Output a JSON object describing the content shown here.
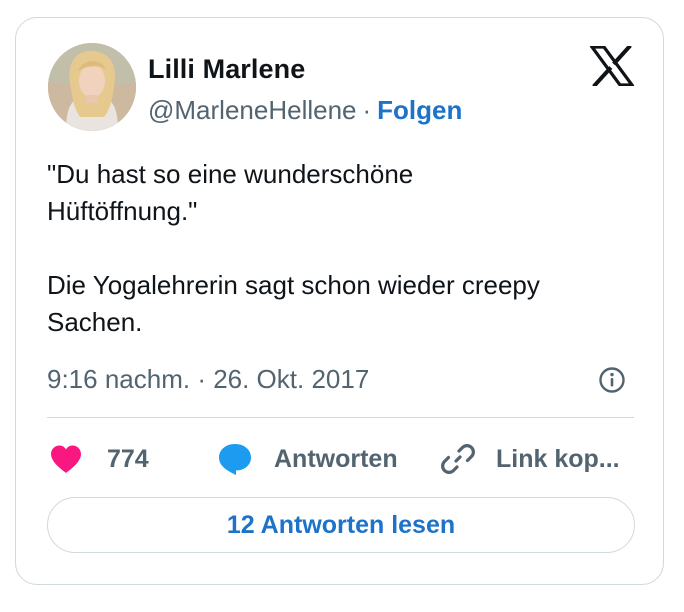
{
  "author": {
    "name": "Lilli Marlene",
    "handle": "@MarleneHellene",
    "separator": "·",
    "follow_label": "Folgen"
  },
  "brand": {
    "logo_icon": "x-logo-icon"
  },
  "tweet": {
    "line1": "\"Du hast so eine wunderschöne",
    "line2": "Hüftöffnung.\"",
    "line3": "Die Yogalehrerin sagt schon wieder creepy",
    "line4": "Sachen.",
    "timestamp": "9:16 nachm. · 26. Okt. 2017"
  },
  "actions": {
    "like_count": "774",
    "reply_label": "Antworten",
    "copy_label": "Link kop..."
  },
  "footer": {
    "read_replies_label": "12 Antworten lesen"
  },
  "colors": {
    "like": "#f91880",
    "reply_icon": "#1d9bf0",
    "link_text": "#1d73c9",
    "muted": "#536471",
    "border": "#cfd9de"
  },
  "icons": [
    "avatar",
    "x-logo-icon",
    "info-icon",
    "heart-icon",
    "speech-bubble-icon",
    "link-icon"
  ]
}
